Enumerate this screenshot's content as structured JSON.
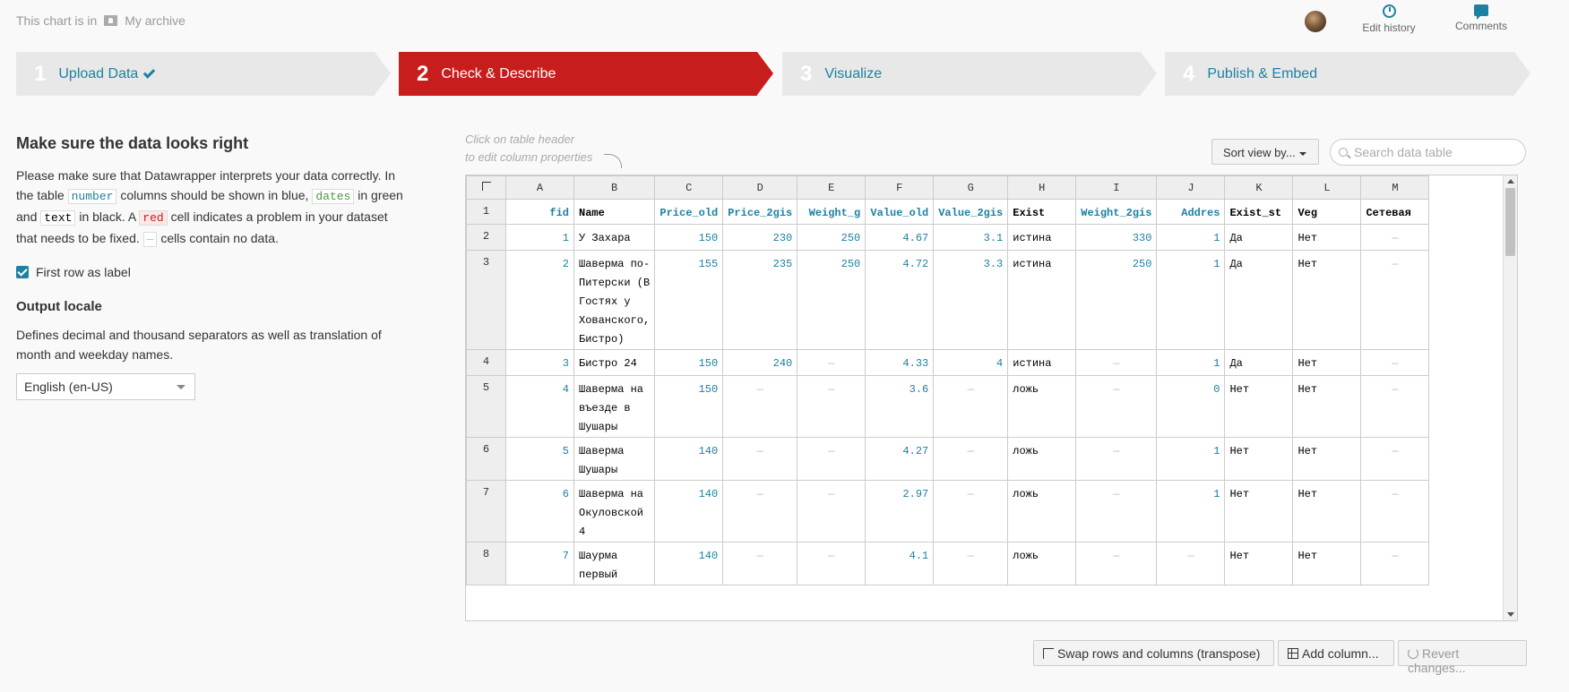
{
  "header": {
    "archive_prefix": "This chart is in",
    "archive_folder": "My archive",
    "edit_history": "Edit history",
    "comments": "Comments"
  },
  "steps": [
    {
      "num": "1",
      "label": "Upload Data",
      "done": true
    },
    {
      "num": "2",
      "label": "Check & Describe",
      "active": true
    },
    {
      "num": "3",
      "label": "Visualize"
    },
    {
      "num": "4",
      "label": "Publish & Embed"
    }
  ],
  "left": {
    "title": "Make sure the data looks right",
    "intro1": "Please make sure that Datawrapper interprets your data correctly. In the table",
    "tag_number": "number",
    "intro2": "columns should be shown in blue,",
    "tag_dates": "dates",
    "intro3": "in green and",
    "tag_text": "text",
    "intro4": "in black. A",
    "tag_red": "red",
    "intro5": "cell indicates a problem in your dataset that needs to be fixed.",
    "tag_none": "—",
    "intro6": "cells contain no data.",
    "first_row_label": "First row as label",
    "locale_title": "Output locale",
    "locale_desc": "Defines decimal and thousand separators as well as translation of month and weekday names.",
    "locale_value": "English (en-US)"
  },
  "table_area": {
    "hint_line1": "Click on table header",
    "hint_line2": "to edit column properties",
    "sort_label": "Sort view by...",
    "search_placeholder": "Search data table"
  },
  "table": {
    "col_letters": [
      "A",
      "B",
      "C",
      "D",
      "E",
      "F",
      "G",
      "H",
      "I",
      "J",
      "K",
      "L",
      "M"
    ],
    "rows": [
      {
        "rn": "1",
        "header": true,
        "cells": [
          "fid",
          "Name",
          "Price_old",
          "Price_2gis",
          "Weight_g",
          "Value_old",
          "Value_2gis",
          "Exist",
          "Weight_2gis",
          "Addres",
          "Exist_st",
          "Veg",
          "Сетевая"
        ]
      },
      {
        "rn": "2",
        "cells": [
          "1",
          "У Захара",
          "150",
          "230",
          "250",
          "4.67",
          "3.1",
          "истина",
          "330",
          "1",
          "Да",
          "Нет",
          "—"
        ]
      },
      {
        "rn": "3",
        "cells": [
          "2",
          "Шаверма по-Питерски (В Гостях у Хованского, Бистро)",
          "155",
          "235",
          "250",
          "4.72",
          "3.3",
          "истина",
          "250",
          "1",
          "Да",
          "Нет",
          "—"
        ]
      },
      {
        "rn": "4",
        "cells": [
          "3",
          "Бистро 24",
          "150",
          "240",
          "—",
          "4.33",
          "4",
          "истина",
          "—",
          "1",
          "Да",
          "Нет",
          "—"
        ]
      },
      {
        "rn": "5",
        "cells": [
          "4",
          "Шаверма на въезде в Шушары",
          "150",
          "—",
          "—",
          "3.6",
          "—",
          "ложь",
          "—",
          "0",
          "Нет",
          "Нет",
          "—"
        ]
      },
      {
        "rn": "6",
        "cells": [
          "5",
          "Шаверма Шушары",
          "140",
          "—",
          "—",
          "4.27",
          "—",
          "ложь",
          "—",
          "1",
          "Нет",
          "Нет",
          "—"
        ]
      },
      {
        "rn": "7",
        "cells": [
          "6",
          "Шаверма на Окуловской 4",
          "140",
          "—",
          "—",
          "2.97",
          "—",
          "ложь",
          "—",
          "1",
          "Нет",
          "Нет",
          "—"
        ]
      },
      {
        "rn": "8",
        "cells": [
          "7",
          "Шаурма первый",
          "140",
          "—",
          "—",
          "4.1",
          "—",
          "ложь",
          "—",
          "—",
          "Нет",
          "Нет",
          "—"
        ]
      }
    ]
  },
  "bottom": {
    "swap": "Swap rows and columns (transpose)",
    "add_column": "Add column...",
    "revert": "Revert changes..."
  },
  "colors": {
    "accent": "#1d81a2",
    "active_step": "#c71e1d"
  }
}
